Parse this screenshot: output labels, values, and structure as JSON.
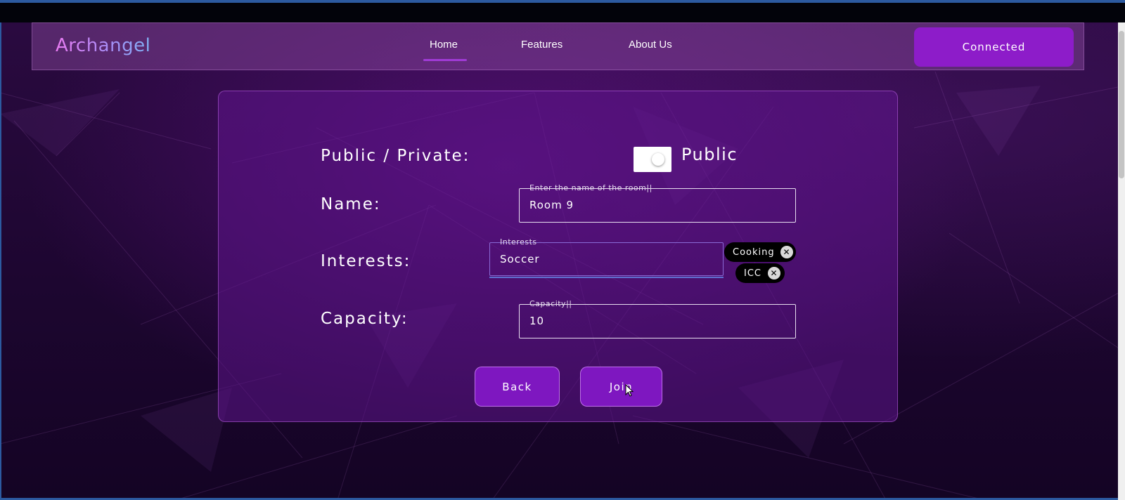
{
  "navbar": {
    "brand": "Archangel",
    "links": [
      {
        "label": "Home",
        "active": true
      },
      {
        "label": "Features",
        "active": false
      },
      {
        "label": "About Us",
        "active": false
      }
    ],
    "status_button": "Connected"
  },
  "form": {
    "visibility": {
      "label": "Public / Private:",
      "toggle_state": "Public"
    },
    "name": {
      "label": "Name:",
      "legend": "Enter the name of the room||",
      "value": "Room 9"
    },
    "interests": {
      "label": "Interests:",
      "legend": "Interests",
      "value": "Soccer",
      "chips": [
        {
          "label": "Cooking"
        },
        {
          "label": "ICC"
        }
      ]
    },
    "capacity": {
      "label": "Capacity:",
      "legend": "Capacity||",
      "value": "10"
    },
    "buttons": {
      "back": "Back",
      "join": "Join"
    }
  },
  "colors": {
    "accent": "#8d1cc9",
    "nav_underline": "#a03bd6",
    "card_bg": "#5f148c",
    "page_bg": "#1d0630"
  },
  "icons": {
    "chip_remove": "close-circle-icon"
  }
}
